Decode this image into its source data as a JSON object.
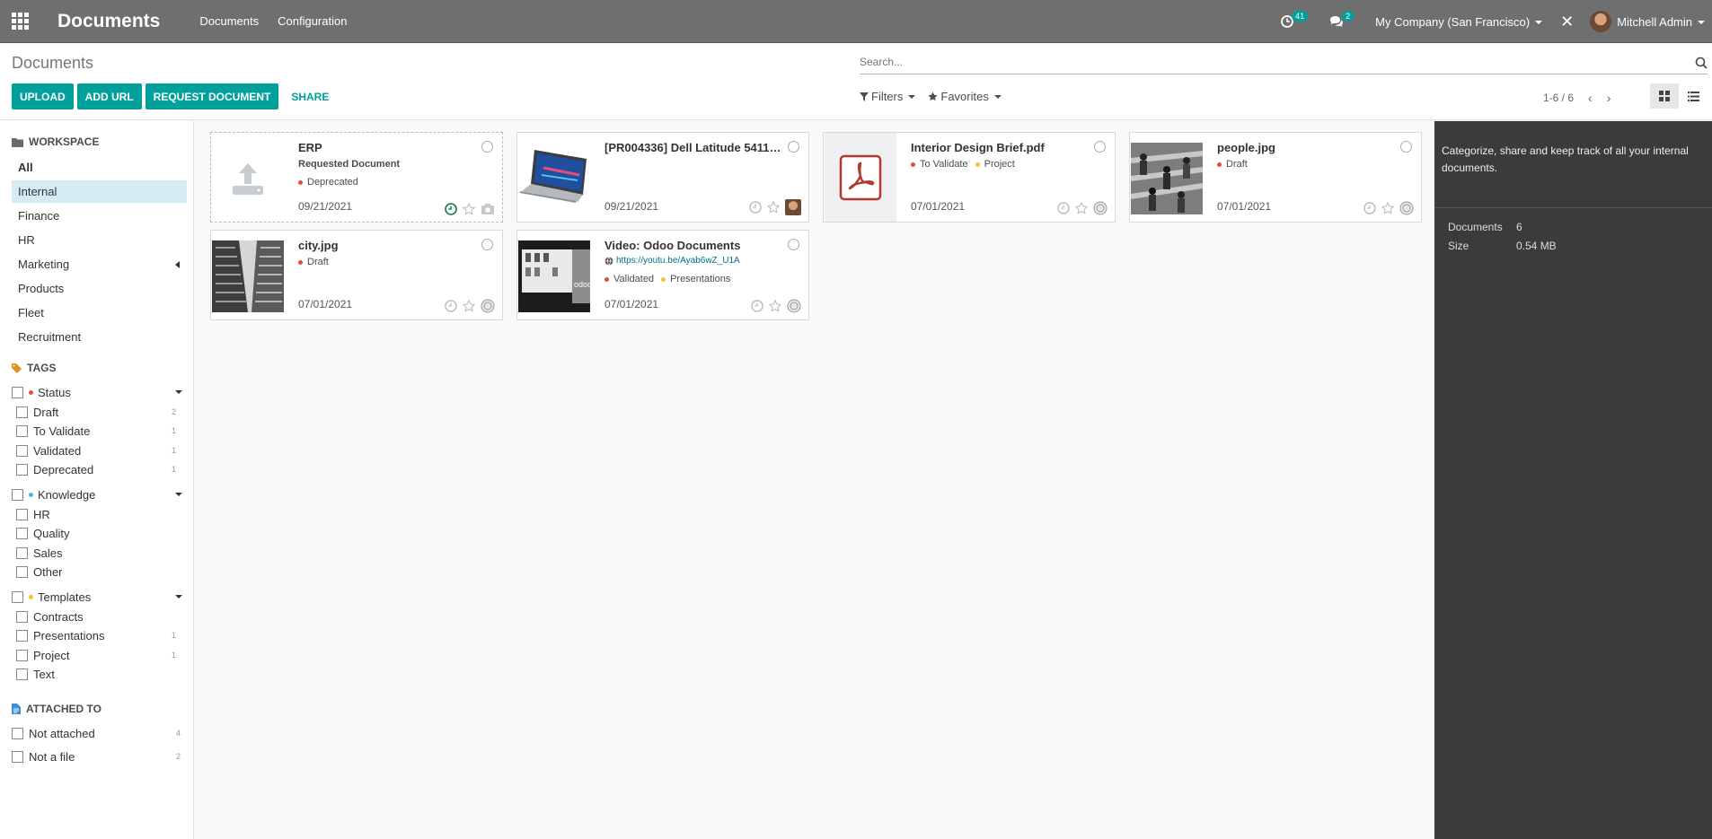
{
  "navbar": {
    "app_title": "Documents",
    "menu": [
      "Documents",
      "Configuration"
    ],
    "activities_count": "41",
    "messages_count": "2",
    "company": "My Company (San Francisco)",
    "user": "Mitchell Admin"
  },
  "control": {
    "breadcrumb": "Documents",
    "search_placeholder": "Search...",
    "buttons": {
      "upload": "UPLOAD",
      "add_url": "ADD URL",
      "request": "REQUEST DOCUMENT",
      "share": "SHARE"
    },
    "filters_label": "Filters",
    "favorites_label": "Favorites",
    "pager": "1-6 / 6"
  },
  "sidebar": {
    "workspace_title": "WORKSPACE",
    "workspaces": [
      "All",
      "Internal",
      "Finance",
      "HR",
      "Marketing",
      "Products",
      "Fleet",
      "Recruitment"
    ],
    "tags_title": "TAGS",
    "facets": [
      {
        "name": "Status",
        "color": "#e74c3c",
        "tags": [
          {
            "name": "Draft",
            "count": "2"
          },
          {
            "name": "To Validate",
            "count": "1"
          },
          {
            "name": "Validated",
            "count": "1"
          },
          {
            "name": "Deprecated",
            "count": "1"
          }
        ]
      },
      {
        "name": "Knowledge",
        "color": "#4db6e4",
        "tags": [
          {
            "name": "HR",
            "count": ""
          },
          {
            "name": "Quality",
            "count": ""
          },
          {
            "name": "Sales",
            "count": ""
          },
          {
            "name": "Other",
            "count": ""
          }
        ]
      },
      {
        "name": "Templates",
        "color": "#f4c430",
        "tags": [
          {
            "name": "Contracts",
            "count": ""
          },
          {
            "name": "Presentations",
            "count": "1"
          },
          {
            "name": "Project",
            "count": "1"
          },
          {
            "name": "Text",
            "count": ""
          }
        ]
      }
    ],
    "attached_title": "ATTACHED TO",
    "attached": [
      {
        "name": "Not attached",
        "count": "4"
      },
      {
        "name": "Not a file",
        "count": "2"
      }
    ]
  },
  "cards": [
    {
      "title": "ERP",
      "subtitle": "Requested Document",
      "tags": [
        {
          "name": "Deprecated",
          "color": "#e74c3c"
        }
      ],
      "date": "09/21/2021"
    },
    {
      "title": "[PR004336] Dell Latitude 5411.p...",
      "tags": [],
      "date": "09/21/2021"
    },
    {
      "title": "Interior Design Brief.pdf",
      "tags": [
        {
          "name": "To Validate",
          "color": "#e74c3c"
        },
        {
          "name": "Project",
          "color": "#f4c430"
        }
      ],
      "date": "07/01/2021"
    },
    {
      "title": "people.jpg",
      "tags": [
        {
          "name": "Draft",
          "color": "#e74c3c"
        }
      ],
      "date": "07/01/2021"
    },
    {
      "title": "city.jpg",
      "tags": [
        {
          "name": "Draft",
          "color": "#e74c3c"
        }
      ],
      "date": "07/01/2021"
    },
    {
      "title": "Video: Odoo Documents",
      "url": "https://youtu.be/Ayab6wZ_U1A",
      "tags": [
        {
          "name": "Validated",
          "color": "#e74c3c"
        },
        {
          "name": "Presentations",
          "color": "#f4c430"
        }
      ],
      "date": "07/01/2021"
    }
  ],
  "inspector": {
    "help": "Categorize, share and keep track of all your internal documents.",
    "documents_label": "Documents",
    "documents_value": "6",
    "size_label": "Size",
    "size_value": "0.54 MB"
  }
}
